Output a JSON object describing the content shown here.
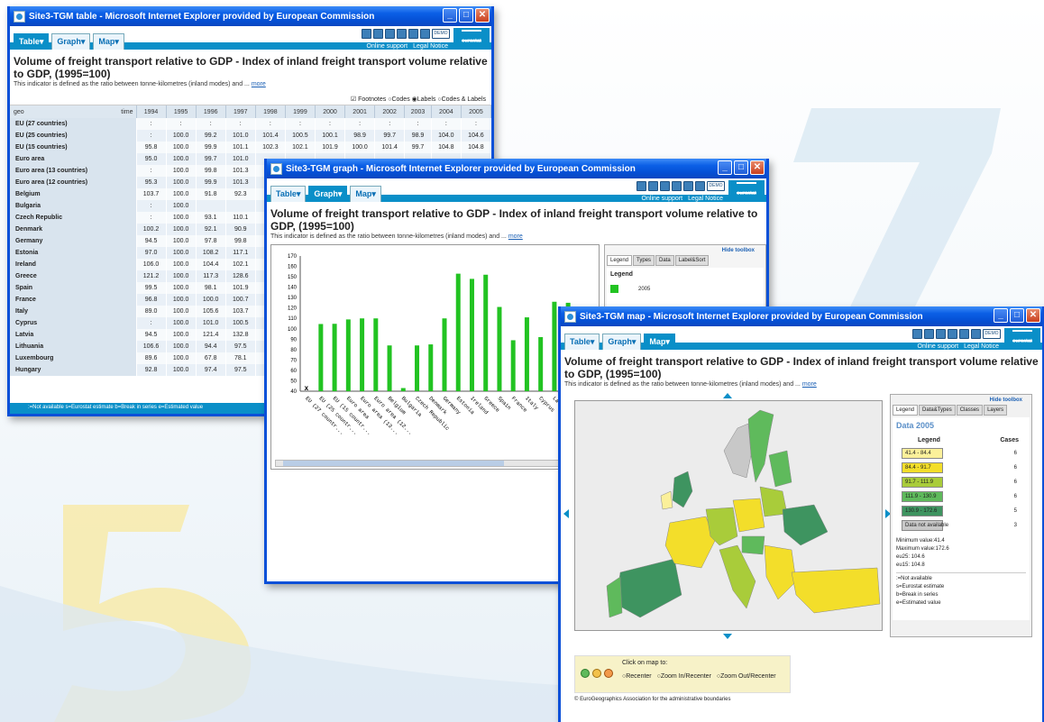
{
  "table_window": {
    "title": "Site3-TGM table - Microsoft Internet Explorer provided by European Commission",
    "tabs": [
      {
        "label": "Table▾",
        "active": true
      },
      {
        "label": "Graph▾",
        "active": false
      },
      {
        "label": "Map▾",
        "active": false
      }
    ],
    "links": [
      "Online support",
      "Legal Notice"
    ],
    "brand": "eurostat",
    "demo": "DEMO",
    "page_title": "Volume of freight transport relative to GDP - Index of inland freight transport volume relative to GDP, (1995=100)",
    "description": "This indicator is defined as the ratio between tonne-kilometres (inland modes) and ...",
    "more": "more",
    "options": {
      "footnotes": "Footnotes",
      "codes": "Codes",
      "labels": "Labels",
      "codes_labels": "Codes & Labels"
    },
    "header": {
      "geo": "geo",
      "time": "time",
      "years": [
        "1994",
        "1995",
        "1996",
        "1997",
        "1998",
        "1999",
        "2000",
        "2001",
        "2002",
        "2003",
        "2004",
        "2005"
      ]
    },
    "rows": [
      {
        "geo": "EU (27 countries)",
        "cells": [
          ":",
          ":",
          ":",
          ":",
          ":",
          ":",
          ":",
          ":",
          ":",
          ":",
          ":",
          ":"
        ]
      },
      {
        "geo": "EU (25 countries)",
        "cells": [
          ":",
          "100.0",
          "99.2",
          "101.0",
          "101.4",
          "100.5",
          "100.1",
          "98.9",
          "99.7",
          "98.9",
          "104.0",
          "104.6"
        ]
      },
      {
        "geo": "EU (15 countries)",
        "cells": [
          "95.8",
          "100.0",
          "99.9",
          "101.1",
          "102.3",
          "102.1",
          "101.9",
          "100.0",
          "101.4",
          "99.7",
          "104.8",
          "104.8"
        ]
      },
      {
        "geo": "Euro area",
        "cells": [
          "95.0",
          "100.0",
          "99.7",
          "101.0",
          "",
          "",
          "",
          "",
          "",
          "",
          "",
          ""
        ]
      },
      {
        "geo": "Euro area (13 countries)",
        "cells": [
          ":",
          "100.0",
          "99.8",
          "101.3",
          "",
          "",
          "",
          "",
          "",
          "",
          "",
          ""
        ]
      },
      {
        "geo": "Euro area (12 countries)",
        "cells": [
          "95.3",
          "100.0",
          "99.9",
          "101.3",
          "",
          "",
          "",
          "",
          "",
          "",
          "",
          ""
        ]
      },
      {
        "geo": "Belgium",
        "cells": [
          "103.7",
          "100.0",
          "91.8",
          "92.3",
          "",
          "",
          "",
          "",
          "",
          "",
          "",
          ""
        ]
      },
      {
        "geo": "Bulgaria",
        "cells": [
          ":",
          "100.0",
          "",
          "",
          "",
          "",
          "",
          "",
          "",
          "",
          "",
          ""
        ]
      },
      {
        "geo": "Czech Republic",
        "cells": [
          ":",
          "100.0",
          "93.1",
          "110.1",
          "",
          "",
          "",
          "",
          "",
          "",
          "",
          ""
        ]
      },
      {
        "geo": "Denmark",
        "cells": [
          "100.2",
          "100.0",
          "92.1",
          "90.9",
          "",
          "",
          "",
          "",
          "",
          "",
          "",
          ""
        ]
      },
      {
        "geo": "Germany",
        "cells": [
          "94.5",
          "100.0",
          "97.8",
          "99.8",
          "",
          "",
          "",
          "",
          "",
          "",
          "",
          ""
        ]
      },
      {
        "geo": "Estonia",
        "cells": [
          "97.0",
          "100.0",
          "108.2",
          "117.1",
          "",
          "",
          "",
          "",
          "",
          "",
          "",
          ""
        ]
      },
      {
        "geo": "Ireland",
        "cells": [
          "106.0",
          "100.0",
          "104.4",
          "102.1",
          "",
          "",
          "",
          "",
          "",
          "",
          "",
          ""
        ]
      },
      {
        "geo": "Greece",
        "cells": [
          "121.2",
          "100.0",
          "117.3",
          "128.6",
          "",
          "",
          "",
          "",
          "",
          "",
          "",
          ""
        ]
      },
      {
        "geo": "Spain",
        "cells": [
          "99.5",
          "100.0",
          "98.1",
          "101.9",
          "",
          "",
          "",
          "",
          "",
          "",
          "",
          ""
        ]
      },
      {
        "geo": "France",
        "cells": [
          "96.8",
          "100.0",
          "100.0",
          "100.7",
          "",
          "",
          "",
          "",
          "",
          "",
          "",
          ""
        ]
      },
      {
        "geo": "Italy",
        "cells": [
          "89.0",
          "100.0",
          "105.6",
          "103.7",
          "",
          "",
          "",
          "",
          "",
          "",
          "",
          ""
        ]
      },
      {
        "geo": "Cyprus",
        "cells": [
          ":",
          "100.0",
          "101.0",
          "100.5",
          "",
          "",
          "",
          "",
          "",
          "",
          "",
          ""
        ]
      },
      {
        "geo": "Latvia",
        "cells": [
          "94.5",
          "100.0",
          "121.4",
          "132.8",
          "",
          "",
          "",
          "",
          "",
          "",
          "",
          ""
        ]
      },
      {
        "geo": "Lithuania",
        "cells": [
          "106.6",
          "100.0",
          "94.4",
          "97.5",
          "",
          "",
          "",
          "",
          "",
          "",
          "",
          ""
        ]
      },
      {
        "geo": "Luxembourg",
        "cells": [
          "89.6",
          "100.0",
          "67.8",
          "78.1",
          "",
          "",
          "",
          "",
          "",
          "",
          "",
          ""
        ]
      },
      {
        "geo": "Hungary",
        "cells": [
          "92.8",
          "100.0",
          "97.4",
          "97.5",
          "",
          "",
          "",
          "",
          "",
          "",
          "",
          ""
        ]
      }
    ],
    "footer": ":=Not available s=Eurostat estimate b=Break in series e=Estimated value"
  },
  "graph_window": {
    "title": "Site3-TGM graph - Microsoft Internet Explorer provided by European Commission",
    "tabs": [
      {
        "label": "Table▾",
        "active": false
      },
      {
        "label": "Graph▾",
        "active": true
      },
      {
        "label": "Map▾",
        "active": false
      }
    ],
    "links": [
      "Online support",
      "Legal Notice"
    ],
    "brand": "eurostat",
    "demo": "DEMO",
    "page_title": "Volume of freight transport relative to GDP - Index of inland freight transport volume relative to GDP, (1995=100)",
    "description": "This indicator is defined as the ratio between tonne-kilometres (inland modes) and ...",
    "more": "more",
    "hide_toolbox": "Hide toolbox",
    "toolbox_tabs": [
      "Legend",
      "Types",
      "Data",
      "Label&Sort"
    ],
    "legend_title": "Legend",
    "legend_item": "2005"
  },
  "chart_data": {
    "type": "bar",
    "title": "",
    "xlabel": "",
    "ylabel": "",
    "ylim": [
      40,
      170
    ],
    "yticks": [
      40,
      50,
      60,
      70,
      80,
      90,
      100,
      110,
      120,
      130,
      140,
      150,
      160,
      170
    ],
    "categories": [
      "EU (27 countr...",
      "EU (25 countr...",
      "EU (15 countr...",
      "Euro area",
      "Euro area (13...",
      "Euro area (12...",
      "Belgium",
      "Bulgaria",
      "Czech Republic",
      "Denmark",
      "Germany",
      "Estonia",
      "Ireland",
      "Greece",
      "Spain",
      "France",
      "Italy",
      "Cyprus",
      "Latvia",
      "Lithuania",
      "Luxe..."
    ],
    "series": [
      {
        "name": "2005",
        "color": "#22c322",
        "values": [
          null,
          104.6,
          104.8,
          109,
          110,
          110,
          84,
          43,
          84,
          85,
          110,
          153,
          148,
          152,
          121,
          89,
          111,
          92,
          126,
          125,
          96
        ]
      }
    ]
  },
  "map_window": {
    "title": "Site3-TGM map - Microsoft Internet Explorer provided by European Commission",
    "tabs": [
      {
        "label": "Table▾",
        "active": false
      },
      {
        "label": "Graph▾",
        "active": false
      },
      {
        "label": "Map▾",
        "active": true
      }
    ],
    "links": [
      "Online support",
      "Legal Notice"
    ],
    "brand": "eurostat",
    "demo": "DEMO",
    "page_title": "Volume of freight transport relative to GDP - Index of inland freight transport volume relative to GDP, (1995=100)",
    "description": "This indicator is defined as the ratio between tonne-kilometres (inland modes) and ...",
    "more": "more",
    "hide_toolbox": "Hide toolbox",
    "toolbox_tabs": [
      "Legend",
      "Data&Types",
      "Classes",
      "Layers"
    ],
    "data_label": "Data 2005",
    "legend_head": "Legend",
    "cases_head": "Cases",
    "legend": [
      {
        "range": "41.4 - 84.4",
        "color": "#fbf09a",
        "cases": "6"
      },
      {
        "range": "84.4 - 91.7",
        "color": "#f3de2a",
        "cases": "6"
      },
      {
        "range": "91.7 - 111.9",
        "color": "#a9cc3a",
        "cases": "6"
      },
      {
        "range": "111.9 - 130.9",
        "color": "#5fba5c",
        "cases": "6"
      },
      {
        "range": "130.9 - 172.6",
        "color": "#3e9460",
        "cases": "5"
      },
      {
        "range": "Data not available",
        "color": "#c8c8c8",
        "cases": "3"
      }
    ],
    "stats": [
      "Minimum value:41.4",
      "Maximum value:172.6",
      "eu25: 104.6",
      "eu15: 104.8"
    ],
    "notes": [
      ":=Not available",
      "s=Eurostat estimate",
      "b=Break in series",
      "e=Estimated value"
    ],
    "click_label": "Click on map to:",
    "radios": [
      "Recenter",
      "Zoom In/Recenter",
      "Zoom Out/Recenter"
    ],
    "copyright": "© EuroGeographics Association for the administrative boundaries"
  }
}
